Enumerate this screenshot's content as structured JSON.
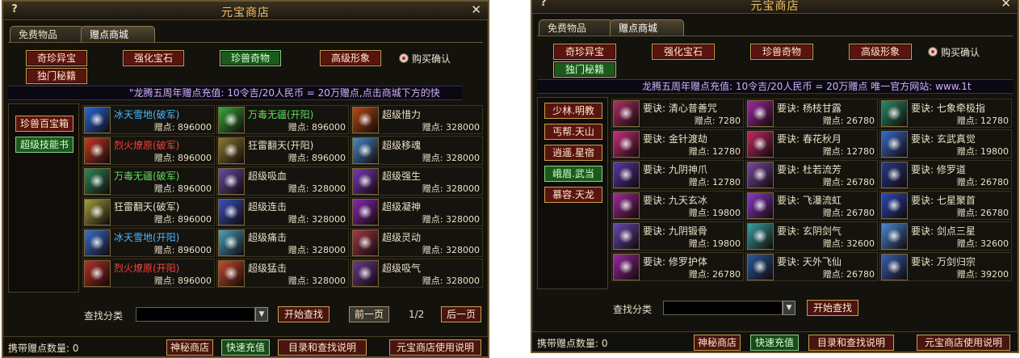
{
  "window": {
    "title": "元宝商店",
    "help_icon": "?",
    "close_icon": "✕"
  },
  "tabs": [
    "免费物品",
    "赠点商城"
  ],
  "purchase_confirm": "购买确认",
  "left": {
    "categories": [
      "奇珍异宝",
      "强化宝石",
      "珍兽奇物",
      "高级形象",
      "独门秘籍"
    ],
    "marquee": "\"龙腾五周年赠点充值: 10令吉/20人民币 = 20万赠点,点击商城下方的快",
    "subcats": [
      "珍兽百宝箱",
      "超级技能书"
    ],
    "items": [
      {
        "name": "冰天雪地(破军)",
        "price": "赠点: 896000",
        "color": "#4ab8ff"
      },
      {
        "name": "万毒无疆(开阳)",
        "price": "赠点: 896000",
        "color": "#5ae05a"
      },
      {
        "name": "超级惜力",
        "price": "赠点: 328000",
        "color": "#e8e0c8"
      },
      {
        "name": "烈火燎原(破军)",
        "price": "赠点: 896000",
        "color": "#ff4040"
      },
      {
        "name": "狂雷翻天(开阳)",
        "price": "赠点: 896000",
        "color": "#e8e0c8"
      },
      {
        "name": "超级移魂",
        "price": "赠点: 328000",
        "color": "#e8e0c8"
      },
      {
        "name": "万毒无疆(破军)",
        "price": "赠点: 896000",
        "color": "#5ae05a"
      },
      {
        "name": "超级吸血",
        "price": "赠点: 328000",
        "color": "#e8e0c8"
      },
      {
        "name": "超级强生",
        "price": "赠点: 328000",
        "color": "#e8e0c8"
      },
      {
        "name": "狂雷翻天(破军)",
        "price": "赠点: 896000",
        "color": "#e8e0c8"
      },
      {
        "name": "超级连击",
        "price": "赠点: 328000",
        "color": "#e8e0c8"
      },
      {
        "name": "超级凝神",
        "price": "赠点: 328000",
        "color": "#e8e0c8"
      },
      {
        "name": "冰天雪地(开阳)",
        "price": "赠点: 896000",
        "color": "#4ab8ff"
      },
      {
        "name": "超级痛击",
        "price": "赠点: 328000",
        "color": "#e8e0c8"
      },
      {
        "name": "超级灵动",
        "price": "赠点: 328000",
        "color": "#e8e0c8"
      },
      {
        "name": "烈火燎原(开阳)",
        "price": "赠点: 896000",
        "color": "#ff4040"
      },
      {
        "name": "超级猛击",
        "price": "赠点: 328000",
        "color": "#e8e0c8"
      },
      {
        "name": "超级吸气",
        "price": "赠点: 328000",
        "color": "#e8e0c8"
      }
    ],
    "search_label": "查找分类",
    "search_button": "开始查找",
    "prev": "前一页",
    "page": "1/2",
    "next": "后一页",
    "carry_points": "携带赠点数量: 0",
    "footer_buttons": [
      "神秘商店",
      "快速充值",
      "目录和查找说明",
      "元宝商店使用说明"
    ]
  },
  "right": {
    "categories": [
      "奇珍异宝",
      "强化宝石",
      "珍兽奇物",
      "高级形象",
      "独门秘籍"
    ],
    "marquee": "龙腾五周年赠点充值: 10令吉/20人民币 = 20万赠点  唯一官方网站: www.1t",
    "subcats": [
      "少林.明教",
      "丐帮.天山",
      "逍遥.星宿",
      "峨眉.武当",
      "慕容.天龙"
    ],
    "items": [
      {
        "name": "要诀: 清心普善咒",
        "price": "赠点: 7280",
        "color": "#e8e0c8"
      },
      {
        "name": "要诀: 杨枝甘露",
        "price": "赠点: 26780",
        "color": "#e8e0c8"
      },
      {
        "name": "要诀: 七象牵极指",
        "price": "赠点: 12780",
        "color": "#e8e0c8"
      },
      {
        "name": "要诀: 金针渡劫",
        "price": "赠点: 12780",
        "color": "#e8e0c8"
      },
      {
        "name": "要诀: 春花秋月",
        "price": "赠点: 12780",
        "color": "#e8e0c8"
      },
      {
        "name": "要诀: 玄武真觉",
        "price": "赠点: 19800",
        "color": "#e8e0c8"
      },
      {
        "name": "要诀: 九阴神爪",
        "price": "赠点: 12780",
        "color": "#e8e0c8"
      },
      {
        "name": "要诀: 杜若流芳",
        "price": "赠点: 26780",
        "color": "#e8e0c8"
      },
      {
        "name": "要诀: 修罗道",
        "price": "赠点: 26780",
        "color": "#e8e0c8"
      },
      {
        "name": "要诀: 九天玄冰",
        "price": "赠点: 19800",
        "color": "#e8e0c8"
      },
      {
        "name": "要诀: 飞瀑流虹",
        "price": "赠点: 26780",
        "color": "#e8e0c8"
      },
      {
        "name": "要诀: 七星聚首",
        "price": "赠点: 26780",
        "color": "#e8e0c8"
      },
      {
        "name": "要诀: 九阴锻骨",
        "price": "赠点: 19800",
        "color": "#e8e0c8"
      },
      {
        "name": "要诀: 玄阴剑气",
        "price": "赠点: 32600",
        "color": "#e8e0c8"
      },
      {
        "name": "要诀: 剑点三星",
        "price": "赠点: 32600",
        "color": "#e8e0c8"
      },
      {
        "name": "要诀: 修罗护体",
        "price": "赠点: 26780",
        "color": "#e8e0c8"
      },
      {
        "name": "要诀: 天外飞仙",
        "price": "赠点: 26780",
        "color": "#e8e0c8"
      },
      {
        "name": "要诀: 万剑归宗",
        "price": "赠点: 39200",
        "color": "#e8e0c8"
      }
    ],
    "search_label": "查找分类",
    "search_button": "开始查找",
    "carry_points": "携带赠点数量: 0",
    "footer_buttons": [
      "神秘商店",
      "快速充值",
      "目录和查找说明",
      "元宝商店使用说明"
    ]
  }
}
